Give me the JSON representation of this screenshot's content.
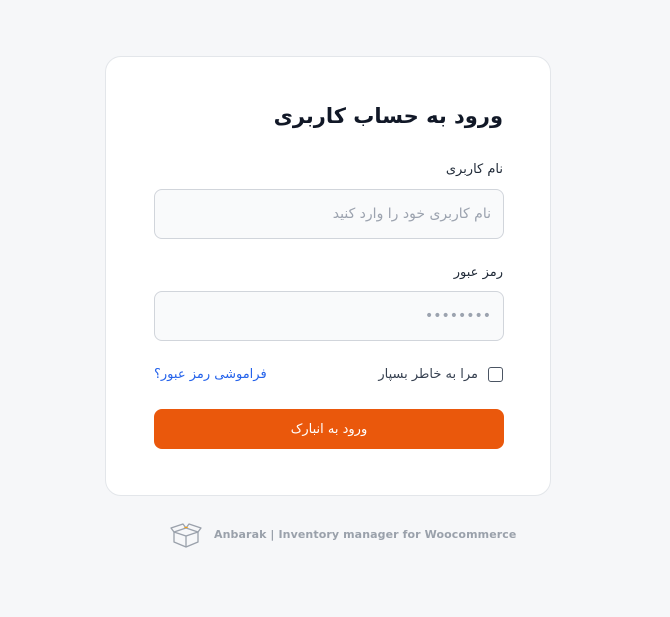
{
  "login": {
    "title": "ورود به حساب کاربری",
    "username_label": "نام کاربری",
    "username_placeholder": "نام کاربری خود را وارد کنید",
    "username_value": "",
    "password_label": "رمز عبور",
    "password_placeholder": "••••••••",
    "password_value": "",
    "remember_label": "مرا به خاطر بسپار",
    "remember_checked": false,
    "forgot_label": "فراموشی رمز عبور؟",
    "submit_label": "ورود به انبارک"
  },
  "footer": {
    "logo_icon": "box-icon",
    "text": "Anbarak | Inventory manager for Woocommerce"
  },
  "colors": {
    "accent": "#ea580c",
    "link": "#2563eb",
    "background": "#f6f7f9"
  }
}
